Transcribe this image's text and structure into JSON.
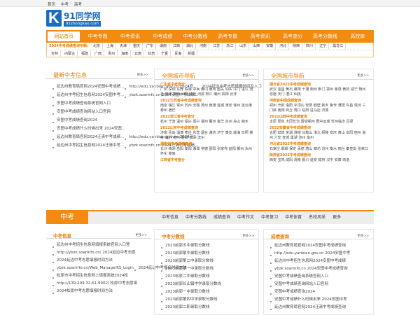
{
  "topbar": {
    "links": [
      "首页",
      "中考",
      "高考"
    ]
  },
  "logo": {
    "k": "K",
    "name": "91同学网",
    "domain": "91zhongkao.com"
  },
  "nav": [
    "网站首页",
    "中考专题",
    "中考资讯",
    "中考成绩",
    "中考分数线",
    "高考专题",
    "高考资讯",
    "高考查分",
    "高考分数线",
    "高校库"
  ],
  "regions": {
    "label": "2024中考成绩查询专题:",
    "row1": [
      "北京",
      "上海",
      "天津",
      "重庆",
      "广东",
      "湖南",
      "江西",
      "湖北",
      "河南",
      "江苏",
      "浙江",
      "山东",
      "山西",
      "安徽",
      "河北",
      "陕西",
      "四川",
      "辽宁",
      "黑龙江"
    ],
    "row2": [
      "吉林",
      "内蒙古",
      "福建",
      "广西",
      "贵州",
      "海南",
      "云南",
      "甘肃",
      "宁夏",
      "青海",
      "新疆"
    ]
  },
  "panel1": {
    "title": "最新中考信息",
    "more": "更多>>",
    "items": [
      "延边州教育局官网2024安图中考成绩...",
      "http://edu.yanbian.gov.cn 2024安...",
      "2024延边中考志愿填报时间及入口",
      "延边州中考招生信息网2024安图中考...",
      "ybzk.soarinfo.cn 2024安图中考成绩...",
      "安图中考成绩查询系统官网入口",
      "安图中考成绩查询网站入口官网",
      "安图中考成绩查询2024",
      "安图中考成绩什么时候出来 2024安图...",
      "延边州教育局官网2024汪清中考成绩...",
      "http://edu.yanbian.gov.cn 2024汪...",
      "延边州中考招生信息网2024汪清中考...",
      "ybzk.soarinfo.cn 2024汪清中考成绩..."
    ]
  },
  "panel2": {
    "title": "全国城市导航",
    "more": "更多>>",
    "groups": [
      {
        "title": "广东省中考查分：",
        "cities": "广州 深圳 东莞 珠海 中山 佛山 惠州 韶关 汕头 江门 湛江 茂名 肇庆 梅州 汕尾 清远 河源 阳江 潮州 揭阳 云浮"
      },
      {
        "title": "2022江苏省中考成绩查询",
        "cities": "南京 镇江 常州 苏州 无锡 扬州 南通 盐城 淮安 徐州 连云港 泰州 宿迁"
      },
      {
        "title": "2022浙江省中考查分",
        "cities": "杭州 宁波 温州 绍兴 嘉兴 湖州 衢州 金华 台州 舟山 丽水"
      },
      {
        "title": "2022山东中考成绩查询",
        "cities": "济南 青岛 淄博 枣庄 东营 烟台 潍坊 济宁 泰安 威海 日照 莱芜 临沂 德州 聊城 菏泽 滨州"
      },
      {
        "title": "湖南省中考成绩查询",
        "cities": "长沙 株洲 岳阳 衡阳 湘潭 常德 邵阳 张家界 益阳 郴州 永州 怀化 娄底"
      },
      {
        "title": "江西省中考查分",
        "cities": ""
      }
    ]
  },
  "panel3": {
    "title": "全国城市导航",
    "more": "更多>>",
    "groups": [
      {
        "title": "湖北省2022中考成绩查询",
        "cities": "武汉 宜昌 黄石 襄阳 十堰 荆州 荆门 鄂州 孝感 黄冈 咸宁 随州 恩施 天门 潜江 仙桃"
      },
      {
        "title": "河南省中招成绩查询",
        "cities": "郑州 开封 洛阳 平顶山 安阳 鹤壁 新乡 焦作 濮阳 许昌 漯河 三门峡 南阳 商丘 周口 信阳 驻马店 济源"
      },
      {
        "title": "2022山西中考成绩查询",
        "cities": "太原 阳泉 大同长治 晋城朔州 晋中运城 忻州临汾 吕梁"
      },
      {
        "title": "2022安徽省中考成绩查询",
        "cities": "合肥 蚌埠 芜湖 淮南 马鞍山 淮北 铜陵 安庆 黄山 阜阳 宿州 滁州 六安 宣城 巢湖 池州 亳州"
      },
      {
        "title": "河北省2022中考成绩查询",
        "cities": "石家庄 邯郸 保定 承德 唐山 廊坊 沧州 衡水 邢台 秦皇岛 张家口"
      },
      {
        "title": "陕西省2022中考成绩查询",
        "cities": "西安 宝鸡 咸阳 渭南 铜川 延安 榆林 汉中 安康 商洛"
      }
    ]
  },
  "bar": {
    "label": "中考",
    "tabs": [
      "中考信息",
      "中考分数线",
      "成绩查询",
      "中考作文",
      "中考复习",
      "中考体育",
      "名校风采",
      "更多"
    ]
  },
  "b1": {
    "title": "中考信息",
    "more": "更多>>",
    "items": [
      "延边州中考招生信息网填报系统官网入口登",
      "http://ybzk.soarinfo.cn/ 2024延边中考志愿",
      "2024延边中考志愿填报时间方法",
      "ybzk.soarinfo.cn/Web_Manage/KS_Login",
      "2024延边中考报名时间方法",
      "松原市中考招生信息网上填报系统2024松",
      "http://139.209.32.61:9902/ 松原中考志愿填",
      "2024松原中考志愿填报时间方法"
    ]
  },
  "b2": {
    "title": "中考分数线",
    "more": "更多>>",
    "items": [
      "2023前郭五中录取分数线",
      "2023前郭蒙中录取分数线",
      "2023前郭第二中录取分数线",
      "2023前郭第一中录取分数线",
      "2023松原二中录取分数线",
      "2023前郭长山镇中学录取分数线",
      "2023前郭一中录取分数线",
      "2023前郭第四中学录取分数线",
      "2023前郭二职录取分数线"
    ]
  },
  "b3": {
    "title": "成绩查询",
    "more": "更多>>",
    "items": [
      "延边州教育局官网2024安图中考成绩查询",
      "http://edu.yanbian.gov.cn 2024安图中考",
      "延边州中考招生信息网2024安图中考成绩",
      "ybzk.soarinfo.cn 2024安图中考成绩查询",
      "安图中考成绩查询系统官网入口",
      "安图中考成绩查询网站入口官网",
      "安图中考成绩查询2024",
      "安图中考成绩什么时候出来 2024安图中考",
      "延边州教育局官网2024汪清中考成绩查询"
    ]
  }
}
